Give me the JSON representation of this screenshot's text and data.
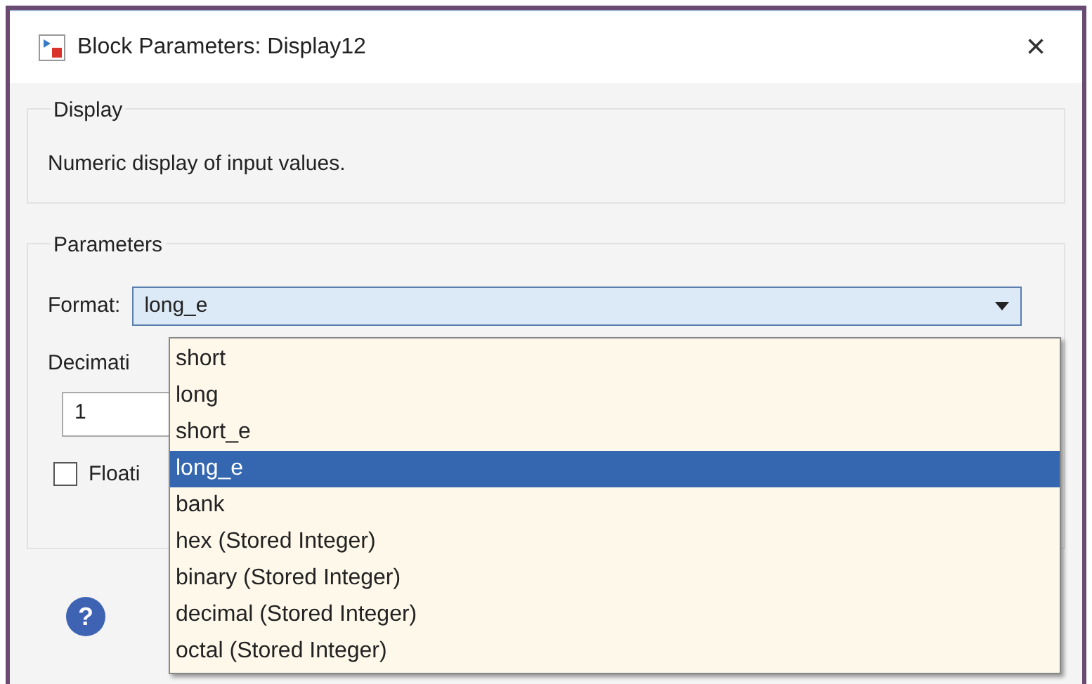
{
  "window": {
    "title": "Block Parameters: Display12",
    "close": "×"
  },
  "display_group": {
    "label": "Display",
    "description": "Numeric display of input values."
  },
  "parameters_group": {
    "label": "Parameters",
    "format": {
      "label": "Format:",
      "value": "long_e",
      "expanded": true,
      "options": [
        {
          "label": "short",
          "selected": false
        },
        {
          "label": "long",
          "selected": false
        },
        {
          "label": "short_e",
          "selected": false
        },
        {
          "label": "long_e",
          "selected": true
        },
        {
          "label": "bank",
          "selected": false
        },
        {
          "label": "hex (Stored Integer)",
          "selected": false
        },
        {
          "label": "binary (Stored Integer)",
          "selected": false
        },
        {
          "label": "decimal (Stored Integer)",
          "selected": false
        },
        {
          "label": "octal (Stored Integer)",
          "selected": false
        }
      ]
    },
    "decimation": {
      "label": "Decimati",
      "value": "1"
    },
    "floating": {
      "label": "Floati",
      "checked": false
    }
  },
  "help": {
    "symbol": "?"
  }
}
